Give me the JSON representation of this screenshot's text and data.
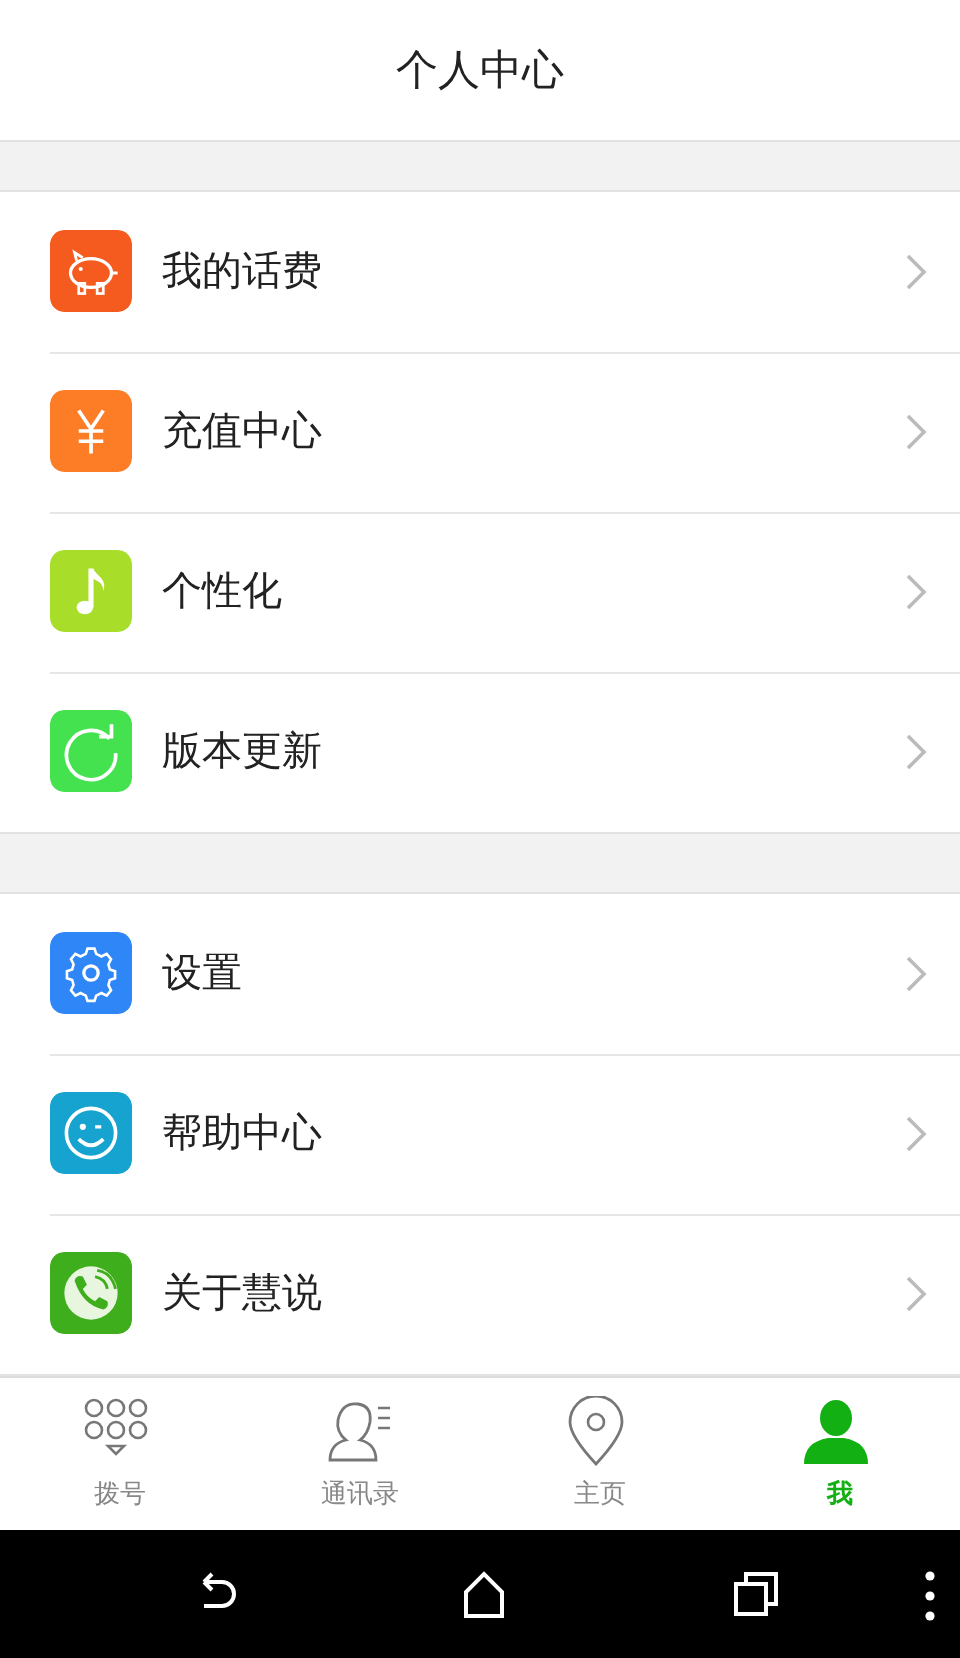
{
  "header": {
    "title": "个人中心"
  },
  "groups": [
    {
      "items": [
        {
          "label": "我的话费",
          "kind": "piggy",
          "color": "#f55a1e"
        },
        {
          "label": "充值中心",
          "kind": "yen",
          "color": "#fd7c26"
        },
        {
          "label": "个性化",
          "kind": "note",
          "color": "#a8de2a"
        },
        {
          "label": "版本更新",
          "kind": "refresh",
          "color": "#44e24f"
        }
      ]
    },
    {
      "items": [
        {
          "label": "设置",
          "kind": "gear",
          "color": "#2f86f6"
        },
        {
          "label": "帮助中心",
          "kind": "smile",
          "color": "#16a3cf"
        },
        {
          "label": "关于慧说",
          "kind": "phone",
          "color": "#3fae1c"
        }
      ]
    }
  ],
  "tabs": [
    {
      "label": "拨号",
      "kind": "dialpad",
      "selected": false
    },
    {
      "label": "通讯录",
      "kind": "contacts",
      "selected": false
    },
    {
      "label": "主页",
      "kind": "location",
      "selected": false
    },
    {
      "label": "我",
      "kind": "person",
      "selected": true
    }
  ]
}
